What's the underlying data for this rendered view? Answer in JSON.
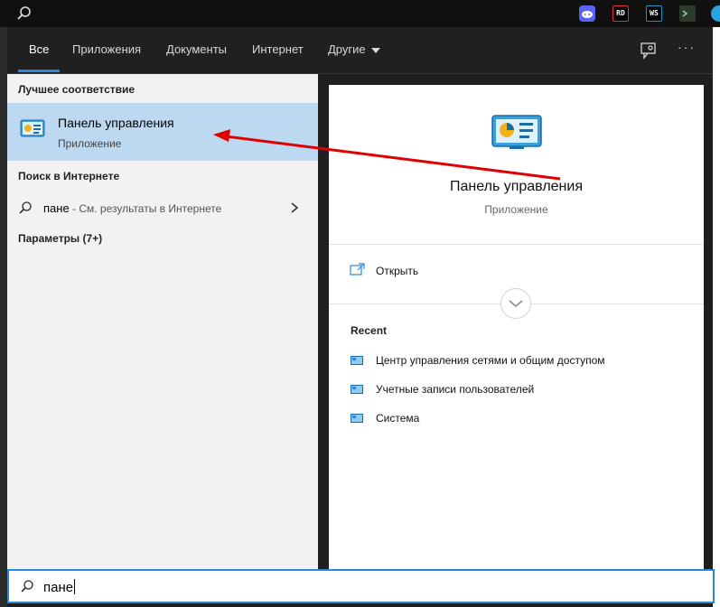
{
  "colors": {
    "accent": "#2b88d8",
    "header_bg": "#202020",
    "selected_bg": "#bdd9f2",
    "annotation_arrow": "#e00000"
  },
  "taskbar": {
    "icons": [
      "search-icon",
      "discord-icon",
      "rider-icon",
      "webstorm-icon",
      "terminal-icon",
      "telegram-icon"
    ],
    "rider_text": "RD",
    "webstorm_text": "WS"
  },
  "header": {
    "tabs": [
      {
        "label": "Все",
        "active": true
      },
      {
        "label": "Приложения"
      },
      {
        "label": "Документы"
      },
      {
        "label": "Интернет"
      },
      {
        "label": "Другие"
      }
    ],
    "more": "···"
  },
  "left": {
    "best_match_title": "Лучшее соответствие",
    "best_match": {
      "name": "Панель управления",
      "subtitle": "Приложение"
    },
    "web_title": "Поиск в Интернете",
    "web_item": {
      "query": "пане",
      "hint": " - См. результаты в Интернете"
    },
    "settings_title": "Параметры (7+)"
  },
  "details": {
    "name": "Панель управления",
    "subtitle": "Приложение",
    "open_label": "Открыть",
    "recent_title": "Recent",
    "recent": [
      {
        "label": "Центр управления сетями и общим доступом"
      },
      {
        "label": "Учетные записи пользователей"
      },
      {
        "label": "Система"
      }
    ]
  },
  "search": {
    "value": "пане"
  }
}
